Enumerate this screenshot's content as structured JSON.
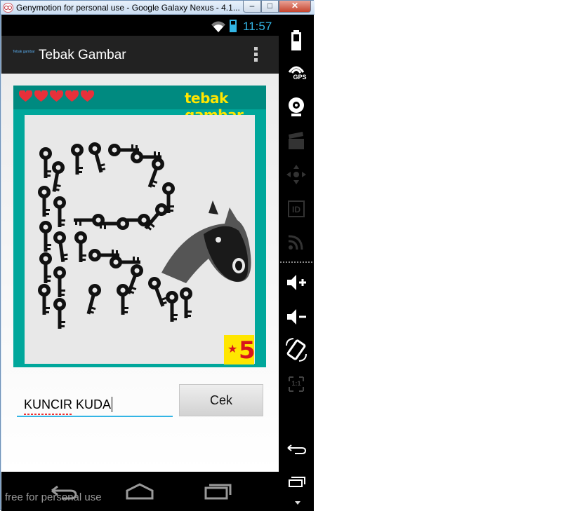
{
  "window": {
    "title": "Genymotion for personal use - Google Galaxy Nexus - 4.1...",
    "minimize": "–",
    "maximize": "□",
    "close": "✕"
  },
  "statusbar": {
    "time": "11:57",
    "icons": [
      "wifi-icon",
      "battery-icon"
    ]
  },
  "actionbar": {
    "logo_text": "Tebak gambar",
    "title": "Tebak Gambar",
    "overflow_icon": "overflow-menu-icon"
  },
  "game": {
    "brand": "tebak gambar",
    "lives": 5,
    "score": "5",
    "score_icon": "star-icon",
    "answer_value": "KUNCIR KUDA",
    "check_button": "Cek",
    "colors": {
      "card": "#00a79b",
      "header": "#008a80",
      "brand": "#ffe600",
      "score": "#d7151c",
      "hearts": "#e8303a"
    }
  },
  "navbar": {
    "buttons": [
      "back-icon",
      "home-icon",
      "recent-apps-icon"
    ],
    "watermark": "free for personal use"
  },
  "sidepanel": {
    "items": [
      "battery-icon",
      "gps-icon",
      "webcam-icon",
      "clapper-icon",
      "dpad-icon",
      "device-id-icon",
      "rss-icon",
      "volume-up-icon",
      "volume-down-icon",
      "rotate-icon",
      "pixel-ratio-icon",
      "back-icon",
      "menu-icon"
    ],
    "gps_label": "GPS",
    "id_label": "ID",
    "ratio_label": "1:1"
  }
}
